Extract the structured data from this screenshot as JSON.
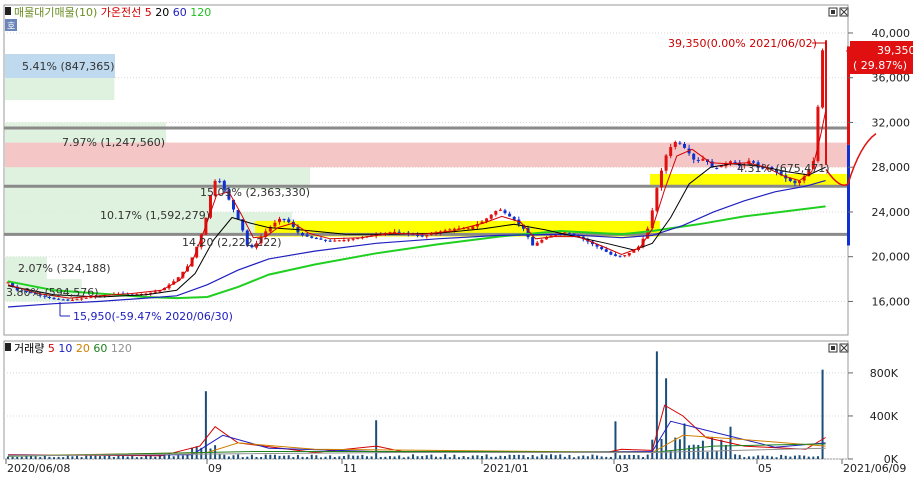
{
  "price_panel": {
    "legend": [
      {
        "text": "매물대기매물(10)",
        "color": "#6b8e23"
      },
      {
        "text": "가온전선",
        "color": "#d40000"
      },
      {
        "text": "5",
        "color": "#d40000"
      },
      {
        "text": "20",
        "color": "#000000"
      },
      {
        "text": "60",
        "color": "#2020c0"
      },
      {
        "text": "120",
        "color": "#20c020"
      }
    ],
    "scale_badge": "호",
    "high_annotation": "39,350(0.00% 2021/06/02)",
    "low_annotation": "15,950(-59.47% 2020/06/30)",
    "current_price": "39,350",
    "current_change": "( 29.87%)",
    "ylim": [
      13000,
      42500
    ],
    "yticks": [
      "16,000",
      "20,000",
      "24,000",
      "28,000",
      "32,000",
      "36,000",
      "40,000"
    ]
  },
  "volume_panel": {
    "legend": [
      {
        "text": "거래량",
        "color": "#000000"
      },
      {
        "text": "5",
        "color": "#d40000"
      },
      {
        "text": "10",
        "color": "#2020c0"
      },
      {
        "text": "20",
        "color": "#d08000"
      },
      {
        "text": "60",
        "color": "#208020"
      },
      {
        "text": "120",
        "color": "#909090"
      }
    ],
    "yticks": [
      "0K",
      "400K",
      "800K"
    ]
  },
  "x_axis": {
    "ticks": [
      "2020/06/08",
      "09",
      "11",
      "2021/01",
      "03",
      "05",
      "2021/06/09"
    ]
  },
  "chart_data": {
    "type": "candlestick",
    "volume_profile": [
      {
        "price_low": 34000,
        "price_high": 38000,
        "pct": 5.41,
        "volume": 847365,
        "label": "5.41% (847,365)"
      },
      {
        "price_low": 30000,
        "price_high": 32000,
        "pct": 7.97,
        "volume": 1247560,
        "label": "7.97% (1,247,560)"
      },
      {
        "price_low": 28000,
        "price_high": 30000,
        "pct": 4.31,
        "volume": 675471,
        "label": "4.31% (675,471)"
      },
      {
        "price_low": 26000,
        "price_high": 28000,
        "pct": 15.09,
        "volume": 2363330,
        "label": "15.09% (2,363,330)"
      },
      {
        "price_low": 24000,
        "price_high": 26000,
        "pct": 10.17,
        "volume": 1592279,
        "label": "10.17% (1,592,279)"
      },
      {
        "price_low": 22000,
        "price_high": 24000,
        "pct": 14.2,
        "volume": 2222222,
        "label": "14.20 (2,222,222)"
      },
      {
        "price_low": 18000,
        "price_high": 20000,
        "pct": 2.07,
        "volume": 324188,
        "label": "2.07% (324,188)"
      },
      {
        "price_low": 16000,
        "price_high": 18000,
        "pct": 3.8,
        "volume": 594576,
        "label": "3.80% (594,576)"
      }
    ],
    "resistance_levels": [
      31500,
      26300,
      22000
    ],
    "price_path": [
      [
        0,
        17700
      ],
      [
        6,
        17000
      ],
      [
        14,
        16800
      ],
      [
        22,
        16500
      ],
      [
        30,
        16200
      ],
      [
        40,
        16100
      ],
      [
        50,
        16300
      ],
      [
        60,
        16500
      ],
      [
        70,
        16700
      ],
      [
        80,
        16600
      ],
      [
        90,
        16700
      ],
      [
        100,
        17000
      ],
      [
        110,
        18000
      ],
      [
        118,
        19300
      ],
      [
        124,
        21200
      ],
      [
        128,
        22800
      ],
      [
        132,
        25500
      ],
      [
        136,
        27200
      ],
      [
        140,
        26300
      ],
      [
        146,
        24500
      ],
      [
        152,
        22800
      ],
      [
        156,
        21000
      ],
      [
        160,
        20800
      ],
      [
        166,
        22000
      ],
      [
        172,
        22800
      ],
      [
        178,
        23500
      ],
      [
        184,
        23000
      ],
      [
        190,
        22000
      ],
      [
        200,
        21600
      ],
      [
        210,
        21400
      ],
      [
        220,
        21500
      ],
      [
        230,
        21700
      ],
      [
        240,
        22000
      ],
      [
        250,
        22200
      ],
      [
        260,
        22100
      ],
      [
        270,
        21800
      ],
      [
        280,
        22200
      ],
      [
        290,
        22500
      ],
      [
        300,
        22500
      ],
      [
        310,
        23200
      ],
      [
        320,
        24300
      ],
      [
        330,
        23300
      ],
      [
        336,
        22500
      ],
      [
        342,
        21000
      ],
      [
        348,
        21500
      ],
      [
        356,
        22000
      ],
      [
        364,
        22200
      ],
      [
        372,
        21800
      ],
      [
        380,
        21200
      ],
      [
        388,
        20600
      ],
      [
        394,
        20100
      ],
      [
        400,
        20000
      ],
      [
        406,
        20400
      ],
      [
        412,
        21000
      ],
      [
        418,
        22800
      ],
      [
        424,
        26800
      ],
      [
        430,
        29500
      ],
      [
        436,
        30400
      ],
      [
        442,
        29600
      ],
      [
        448,
        28500
      ],
      [
        454,
        28800
      ],
      [
        460,
        27800
      ],
      [
        466,
        28200
      ],
      [
        472,
        28600
      ],
      [
        478,
        28000
      ],
      [
        484,
        28700
      ],
      [
        490,
        27800
      ],
      [
        496,
        28000
      ],
      [
        502,
        27500
      ],
      [
        508,
        26900
      ],
      [
        514,
        26500
      ],
      [
        520,
        27300
      ],
      [
        526,
        28800
      ],
      [
        530,
        38000
      ],
      [
        533,
        39350
      ]
    ],
    "ma5_path": [
      [
        0,
        17500
      ],
      [
        20,
        16700
      ],
      [
        40,
        16300
      ],
      [
        60,
        16500
      ],
      [
        80,
        16700
      ],
      [
        100,
        17000
      ],
      [
        112,
        17900
      ],
      [
        120,
        19500
      ],
      [
        128,
        22400
      ],
      [
        136,
        25500
      ],
      [
        144,
        25800
      ],
      [
        152,
        23800
      ],
      [
        160,
        21700
      ],
      [
        168,
        21800
      ],
      [
        176,
        22600
      ],
      [
        186,
        23000
      ],
      [
        196,
        22100
      ],
      [
        210,
        21600
      ],
      [
        230,
        21700
      ],
      [
        250,
        22100
      ],
      [
        270,
        22000
      ],
      [
        290,
        22300
      ],
      [
        310,
        23000
      ],
      [
        322,
        23600
      ],
      [
        334,
        23100
      ],
      [
        344,
        21600
      ],
      [
        356,
        21800
      ],
      [
        372,
        21800
      ],
      [
        388,
        20900
      ],
      [
        400,
        20200
      ],
      [
        412,
        20800
      ],
      [
        420,
        22500
      ],
      [
        428,
        26000
      ],
      [
        436,
        29000
      ],
      [
        446,
        29600
      ],
      [
        458,
        28400
      ],
      [
        470,
        28300
      ],
      [
        482,
        28400
      ],
      [
        494,
        28000
      ],
      [
        506,
        27200
      ],
      [
        516,
        26800
      ],
      [
        524,
        27600
      ],
      [
        530,
        31000
      ],
      [
        533,
        33000
      ]
    ],
    "ma20_path": [
      [
        0,
        17400
      ],
      [
        30,
        16600
      ],
      [
        60,
        16400
      ],
      [
        90,
        16600
      ],
      [
        110,
        17000
      ],
      [
        122,
        18500
      ],
      [
        134,
        21500
      ],
      [
        146,
        23500
      ],
      [
        158,
        23000
      ],
      [
        170,
        22600
      ],
      [
        190,
        22400
      ],
      [
        220,
        22000
      ],
      [
        250,
        22000
      ],
      [
        280,
        22100
      ],
      [
        310,
        22500
      ],
      [
        330,
        22900
      ],
      [
        350,
        22400
      ],
      [
        370,
        21800
      ],
      [
        390,
        21200
      ],
      [
        408,
        20600
      ],
      [
        420,
        21200
      ],
      [
        432,
        23500
      ],
      [
        444,
        26500
      ],
      [
        458,
        28000
      ],
      [
        472,
        28300
      ],
      [
        490,
        28100
      ],
      [
        508,
        27600
      ],
      [
        522,
        27300
      ],
      [
        533,
        28000
      ]
    ],
    "ma60_path": [
      [
        0,
        15500
      ],
      [
        30,
        15800
      ],
      [
        60,
        16000
      ],
      [
        90,
        16300
      ],
      [
        110,
        16500
      ],
      [
        130,
        17500
      ],
      [
        150,
        18800
      ],
      [
        170,
        19800
      ],
      [
        200,
        20500
      ],
      [
        240,
        21200
      ],
      [
        280,
        21600
      ],
      [
        320,
        21900
      ],
      [
        360,
        22000
      ],
      [
        400,
        21700
      ],
      [
        420,
        21900
      ],
      [
        440,
        22800
      ],
      [
        460,
        24000
      ],
      [
        480,
        25000
      ],
      [
        500,
        25800
      ],
      [
        520,
        26300
      ],
      [
        533,
        26800
      ]
    ],
    "ma120_path": [
      [
        0,
        17800
      ],
      [
        30,
        17000
      ],
      [
        60,
        16700
      ],
      [
        90,
        16400
      ],
      [
        110,
        16300
      ],
      [
        130,
        16400
      ],
      [
        150,
        17300
      ],
      [
        170,
        18400
      ],
      [
        200,
        19300
      ],
      [
        240,
        20300
      ],
      [
        280,
        21100
      ],
      [
        320,
        21800
      ],
      [
        360,
        22300
      ],
      [
        400,
        22000
      ],
      [
        420,
        22300
      ],
      [
        450,
        22900
      ],
      [
        480,
        23600
      ],
      [
        510,
        24100
      ],
      [
        533,
        24500
      ]
    ],
    "volume_spikes": [
      [
        128,
        420000
      ],
      [
        130,
        630000
      ],
      [
        240,
        360000
      ],
      [
        395,
        350000
      ],
      [
        424,
        1000000
      ],
      [
        428,
        750000
      ],
      [
        440,
        330000
      ],
      [
        470,
        300000
      ],
      [
        530,
        250000
      ],
      [
        532,
        830000
      ]
    ]
  }
}
